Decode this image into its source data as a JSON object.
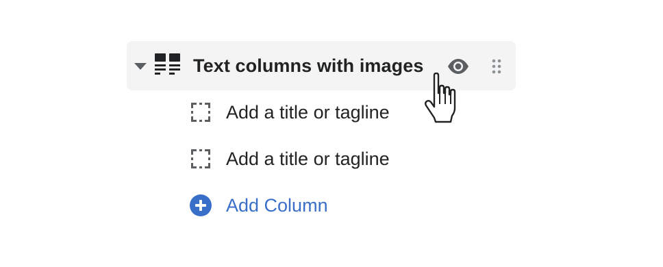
{
  "section": {
    "title": "Text columns with images",
    "caret_icon": "caret-down-icon",
    "type_icon": "text-columns-icon",
    "visibility_icon": "eye-icon",
    "drag_icon": "drag-handle-icon"
  },
  "blocks": [
    {
      "label": "Add a title or tagline",
      "icon": "frame-icon"
    },
    {
      "label": "Add a title or tagline",
      "icon": "frame-icon"
    }
  ],
  "add_block": {
    "label": "Add Column",
    "icon": "plus-circle-icon"
  },
  "colors": {
    "row_background": "#f4f4f4",
    "text": "#202223",
    "icon": "#5c5f62",
    "accent": "#3a6fc9"
  },
  "cursor": {
    "icon": "hand-pointer-icon"
  }
}
